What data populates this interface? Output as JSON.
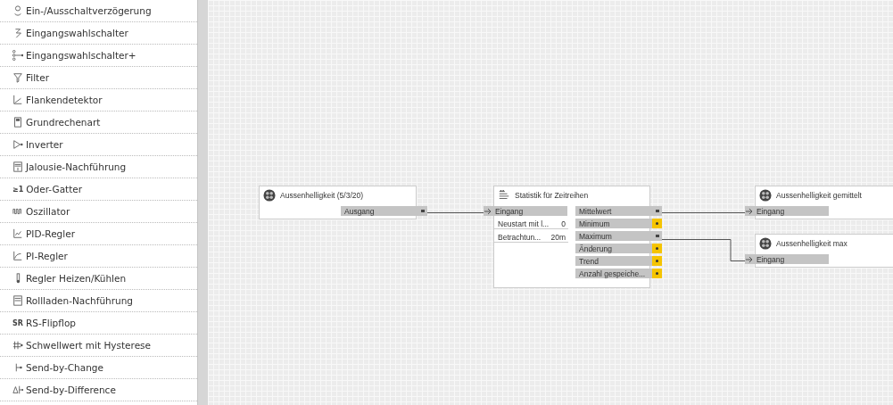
{
  "sidebar": {
    "items": [
      {
        "label": "Ein-/Ausschaltverzögerung"
      },
      {
        "label": "Eingangswahlschalter"
      },
      {
        "label": "Eingangswahlschalter+"
      },
      {
        "label": "Filter"
      },
      {
        "label": "Flankendetektor"
      },
      {
        "label": "Grundrechenart"
      },
      {
        "label": "Inverter"
      },
      {
        "label": "Jalousie-Nachführung"
      },
      {
        "label": "Oder-Gatter",
        "glyph": "≥1"
      },
      {
        "label": "Oszillator"
      },
      {
        "label": "PID-Regler"
      },
      {
        "label": "PI-Regler"
      },
      {
        "label": "Regler Heizen/Kühlen"
      },
      {
        "label": "Rollladen-Nachführung"
      },
      {
        "label": "RS-Flipflop",
        "glyph": "SR"
      },
      {
        "label": "Schwellwert mit Hysterese"
      },
      {
        "label": "Send-by-Change"
      },
      {
        "label": "Send-by-Difference"
      }
    ]
  },
  "canvas": {
    "nodes": [
      {
        "kind": "sensor",
        "title": "Aussenhelligkeit (5/3/20)",
        "outputs": [
          {
            "label": "Ausgang",
            "connected": true
          }
        ]
      },
      {
        "kind": "function",
        "title": "Statistik für Zeitreihen",
        "inputs": [
          {
            "kind": "port",
            "label": "Eingang"
          },
          {
            "kind": "param",
            "label": "Neustart mit l...",
            "value": "0"
          },
          {
            "kind": "param",
            "label": "Betrachtun...",
            "value": "20m"
          }
        ],
        "outputs": [
          {
            "label": "Mittelwert",
            "connected": true
          },
          {
            "label": "Minimum",
            "connected": false
          },
          {
            "label": "Maximum",
            "connected": true
          },
          {
            "label": "Änderung",
            "connected": false
          },
          {
            "label": "Trend",
            "connected": false
          },
          {
            "label": "Anzahl gespeiche...",
            "connected": false
          }
        ]
      },
      {
        "kind": "sensor",
        "title": "Aussenhelligkeit gemittelt",
        "inputs": [
          {
            "kind": "port",
            "label": "Eingang"
          }
        ]
      },
      {
        "kind": "sensor",
        "title": "Aussenhelligkeit max",
        "inputs": [
          {
            "kind": "port",
            "label": "Eingang"
          }
        ]
      }
    ]
  }
}
